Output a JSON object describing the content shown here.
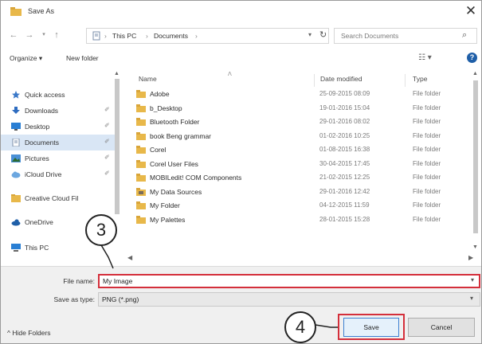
{
  "window": {
    "title": "Save As"
  },
  "address_bar": {
    "path": [
      "This PC",
      "Documents"
    ]
  },
  "search": {
    "placeholder": "Search Documents"
  },
  "toolbar": {
    "organize": "Organize ▾",
    "new_folder": "New folder"
  },
  "nav_pane": {
    "items": [
      {
        "label": "Quick access",
        "icon": "star-icon",
        "pinned": false,
        "selected": false
      },
      {
        "label": "Downloads",
        "icon": "download-icon",
        "pinned": true,
        "selected": false
      },
      {
        "label": "Desktop",
        "icon": "desktop-icon",
        "pinned": true,
        "selected": false
      },
      {
        "label": "Documents",
        "icon": "document-icon",
        "pinned": true,
        "selected": true
      },
      {
        "label": "Pictures",
        "icon": "picture-icon",
        "pinned": true,
        "selected": false
      },
      {
        "label": "iCloud Drive",
        "icon": "cloud-icon",
        "pinned": true,
        "selected": false
      },
      {
        "label": "Creative Cloud Fil",
        "icon": "creative-cloud-icon",
        "pinned": false,
        "selected": false
      },
      {
        "label": "OneDrive",
        "icon": "onedrive-icon",
        "pinned": false,
        "selected": false
      },
      {
        "label": "This PC",
        "icon": "computer-icon",
        "pinned": false,
        "selected": false
      }
    ]
  },
  "file_list": {
    "columns": [
      "Name",
      "Date modified",
      "Type"
    ],
    "rows": [
      {
        "name": "Adobe",
        "date": "25-09-2015 08:09",
        "type": "File folder"
      },
      {
        "name": "b_Desktop",
        "date": "19-01-2016 15:04",
        "type": "File folder"
      },
      {
        "name": "Bluetooth Folder",
        "date": "29-01-2016 08:02",
        "type": "File folder"
      },
      {
        "name": "book Beng grammar",
        "date": "01-02-2016 10:25",
        "type": "File folder"
      },
      {
        "name": "Corel",
        "date": "01-08-2015 16:38",
        "type": "File folder"
      },
      {
        "name": "Corel User Files",
        "date": "30-04-2015 17:45",
        "type": "File folder"
      },
      {
        "name": "MOBILedit! COM Components",
        "date": "21-02-2015 12:25",
        "type": "File folder"
      },
      {
        "name": "My Data Sources",
        "date": "29-01-2016 12:42",
        "type": "File folder"
      },
      {
        "name": "My Folder",
        "date": "04-12-2015 11:59",
        "type": "File folder"
      },
      {
        "name": "My Palettes",
        "date": "28-01-2015 15:28",
        "type": "File folder"
      }
    ]
  },
  "form": {
    "filename_label": "File name:",
    "filename_value": "My Image",
    "savetype_label": "Save as type:",
    "savetype_value": "PNG (*.png)",
    "hide_folders": "^ Hide Folders",
    "save_button": "Save",
    "cancel_button": "Cancel"
  },
  "callouts": {
    "filename_step": "3",
    "save_step": "4"
  },
  "colors": {
    "highlight": "#d42f3b",
    "folder": "#e8b84a",
    "selected_bg": "#d9e6f5",
    "help": "#1f5fa8"
  }
}
